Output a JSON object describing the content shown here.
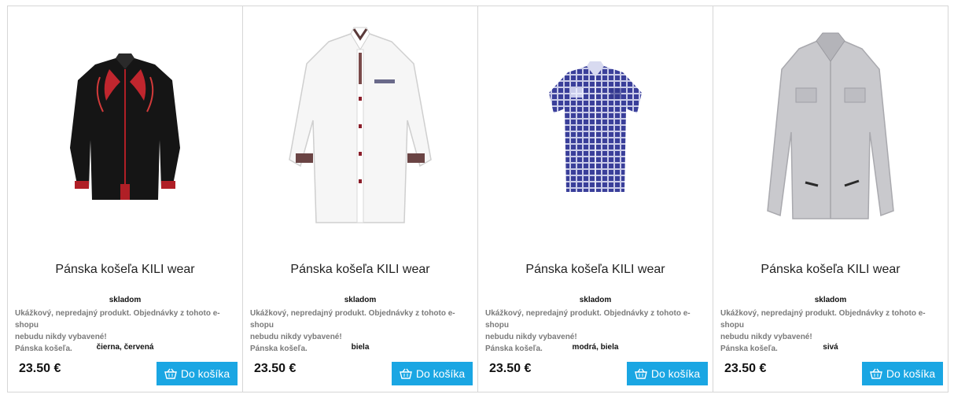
{
  "products": [
    {
      "title": "Pánska košeľa KILI wear",
      "stock": "skladom",
      "desc_line1": "Ukážkový, nepredajný produkt. Objednávky z tohoto e-shopu",
      "desc_line2": "nebudu nikdy vybavené!",
      "desc_line3": "Pánska košeľa.",
      "colors": "čierna, červená",
      "price": "23.50 €",
      "cart_label": "Do košíka",
      "cart_icon": "basket-icon",
      "image": "black long-sleeve shirt with red embroidery"
    },
    {
      "title": "Pánska košeľa KILI wear",
      "stock": "skladom",
      "desc_line1": "Ukážkový, nepredajný produkt. Objednávky z tohoto e-shopu",
      "desc_line2": "nebudu nikdy vybavené!",
      "desc_line3": "Pánska košeľa.",
      "colors": "biela",
      "price": "23.50 €",
      "cart_label": "Do košíka",
      "cart_icon": "basket-icon",
      "image": "white long-sleeve shirt with paisley cuffs"
    },
    {
      "title": "Pánska košeľa KILI wear",
      "stock": "skladom",
      "desc_line1": "Ukážkový, nepredajný produkt. Objednávky z tohoto e-shopu",
      "desc_line2": "nebudu nikdy vybavené!",
      "desc_line3": "Pánska košeľa.",
      "colors": "modrá, biela",
      "price": "23.50 €",
      "cart_label": "Do košíka",
      "cart_icon": "basket-icon",
      "image": "blue checked short-sleeve shirt"
    },
    {
      "title": "Pánska košeľa KILI wear",
      "stock": "skladom",
      "desc_line1": "Ukážkový, nepredajný produkt. Objednávky z tohoto e-shopu",
      "desc_line2": "nebudu nikdy vybavené!",
      "desc_line3": "Pánska košeľa.",
      "colors": "sivá",
      "price": "23.50 €",
      "cart_label": "Do košíka",
      "cart_icon": "basket-icon",
      "image": "grey long-sleeve shirt with chest pockets"
    }
  ],
  "colors": {
    "cart_button": "#1aa6e3",
    "border": "#d6d6d6",
    "desc_text": "#7a7a7a"
  }
}
